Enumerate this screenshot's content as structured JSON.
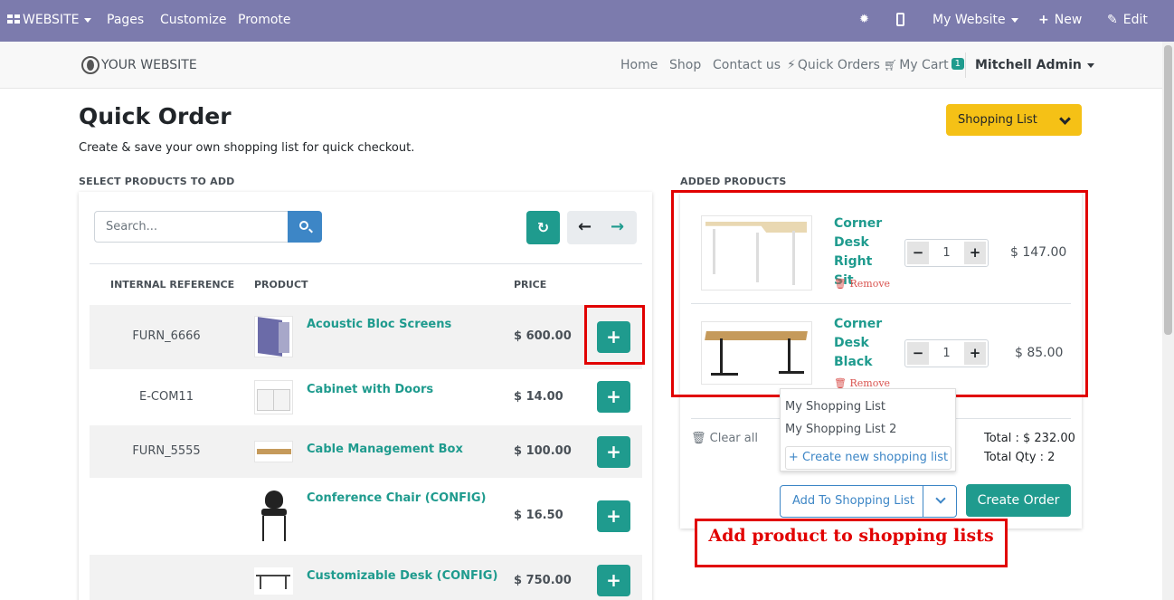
{
  "admin_bar": {
    "website": "WEBSITE",
    "pages": "Pages",
    "customize": "Customize",
    "promote": "Promote",
    "my_website": "My Website",
    "new": "New",
    "edit": "Edit"
  },
  "header": {
    "logo": "YOUR WEBSITE",
    "nav": [
      "Home",
      "Shop",
      "Contact us",
      "Quick Orders",
      "My Cart"
    ],
    "cart_count": "1",
    "user": "Mitchell Admin"
  },
  "page": {
    "title": "Quick Order",
    "subtitle": "Create & save your own shopping list for quick checkout.",
    "shopping_list_button": "Shopping List",
    "select_label": "SELECT PRODUCTS TO ADD",
    "added_label": "ADDED PRODUCTS"
  },
  "search": {
    "placeholder": "Search..."
  },
  "table": {
    "headers": [
      "INTERNAL REFERENCE",
      "PRODUCT",
      "PRICE"
    ],
    "rows": [
      {
        "ref": "FURN_6666",
        "product": "Acoustic Bloc Screens",
        "price": "$ 600.00"
      },
      {
        "ref": "E-COM11",
        "product": "Cabinet with Doors",
        "price": "$ 14.00"
      },
      {
        "ref": "FURN_5555",
        "product": "Cable Management Box",
        "price": "$ 100.00"
      },
      {
        "ref": "",
        "product": "Conference Chair (CONFIG)",
        "price": "$ 16.50"
      },
      {
        "ref": "",
        "product": "Customizable Desk (CONFIG)",
        "price": "$ 750.00"
      }
    ],
    "add_icon": "+"
  },
  "cart": {
    "items": [
      {
        "name": "Corner Desk Right Sit",
        "qty": "1",
        "price": "$ 147.00",
        "remove": "Remove"
      },
      {
        "name": "Corner Desk Black",
        "qty": "1",
        "price": "$ 85.00",
        "remove": "Remove"
      }
    ],
    "clear_all": "Clear all",
    "total": "Total : $ 232.00",
    "total_qty": "Total Qty : 2"
  },
  "shopping_lists": {
    "options": [
      "My Shopping List",
      "My Shopping List 2"
    ],
    "create_new": "+ Create new shopping list",
    "add_button": "Add To Shopping List"
  },
  "create_order": "Create Order",
  "annotation": "Add product to shopping lists",
  "colors": {
    "admin_bar": "#7c7bad",
    "primary": "#1f9b8e",
    "link_blue": "#3d86c6",
    "shopping_list_button": "#f5c116",
    "highlight": "#e10000"
  }
}
